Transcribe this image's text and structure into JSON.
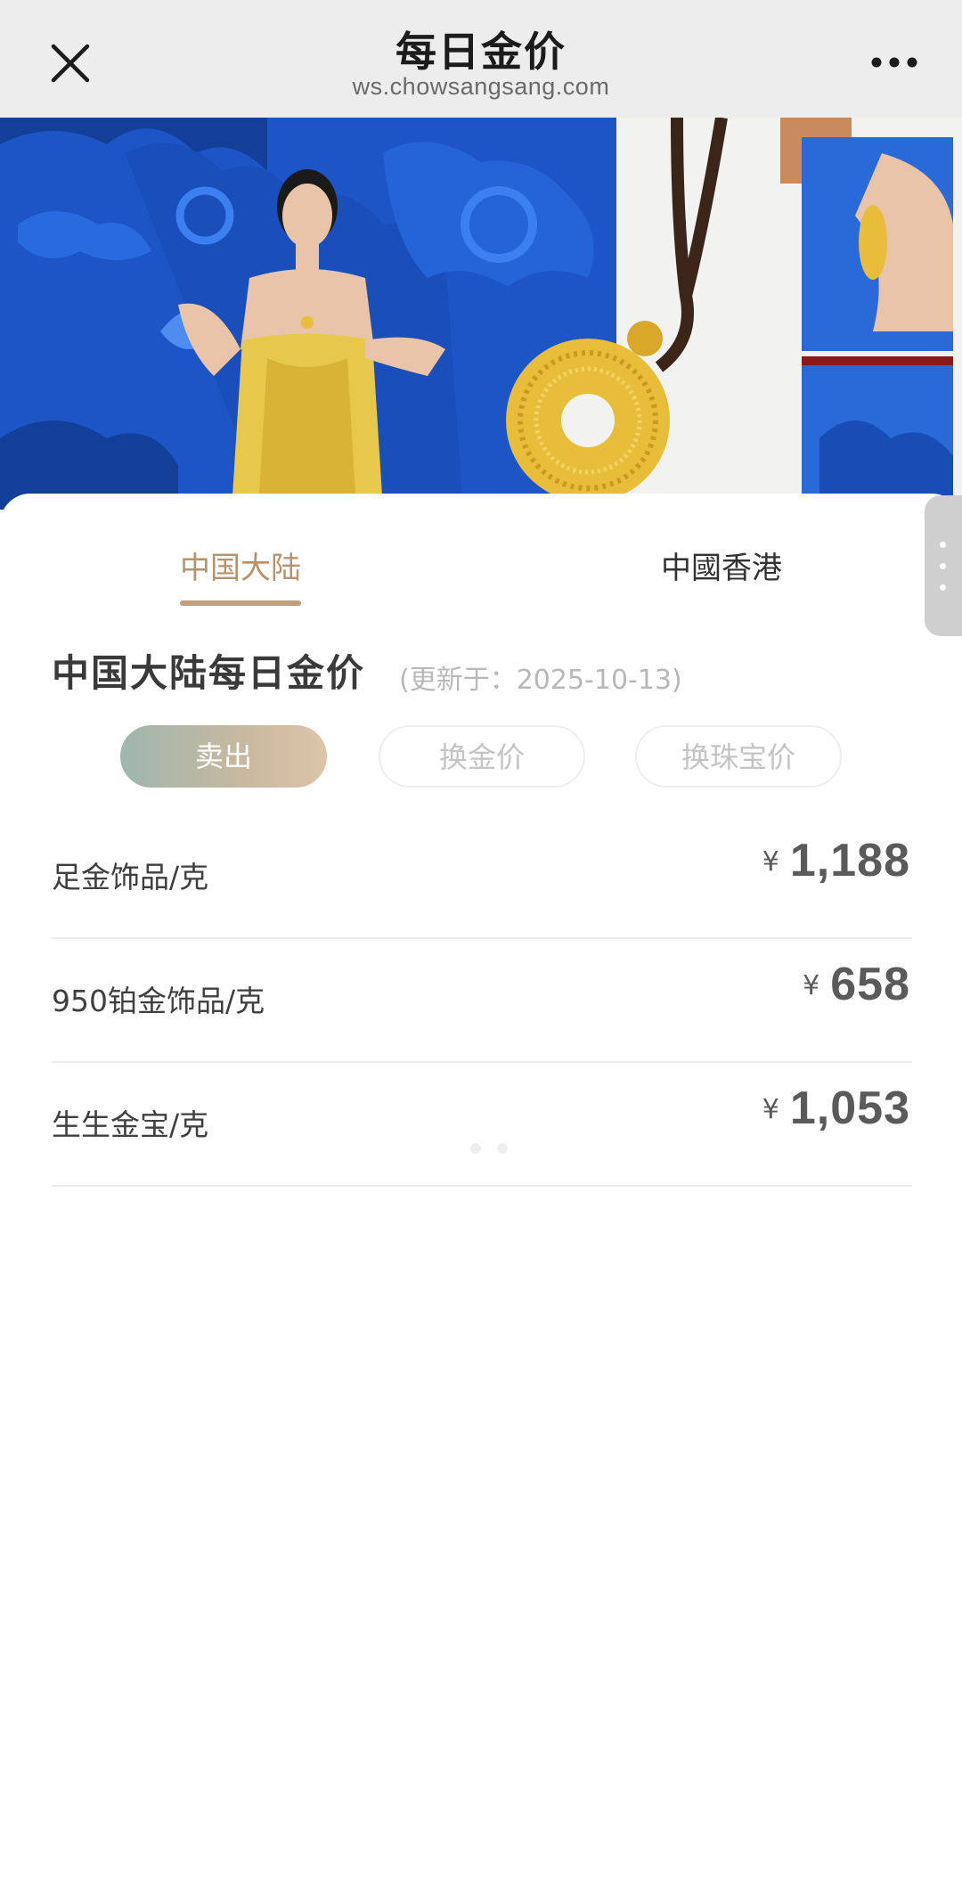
{
  "navbar": {
    "title": "每日金价",
    "url": "ws.chowsangsang.com",
    "close_icon": "close-icon",
    "more_icon": "more-dots-icon"
  },
  "banner": {
    "description_icon": "promo-banner-image"
  },
  "tabs": [
    {
      "label": "中国大陆",
      "active": true
    },
    {
      "label": "中國香港",
      "active": false
    }
  ],
  "section": {
    "title": "中国大陆每日金价",
    "updated": "(更新于：2025-10-13)"
  },
  "price_types": [
    {
      "label": "卖出",
      "active": true
    },
    {
      "label": "换金价",
      "active": false
    },
    {
      "label": "换珠宝价",
      "active": false
    }
  ],
  "prices": [
    {
      "item": "足金饰品/克",
      "currency": "¥",
      "amount": "1,188"
    },
    {
      "item": "950铂金饰品/克",
      "currency": "¥",
      "amount": "658"
    },
    {
      "item": "生生金宝/克",
      "currency": "¥",
      "amount": "1,053"
    }
  ],
  "colors": {
    "accent": "#b8926a",
    "nav_bg": "#ededed",
    "banner_blue": "#1f56c4",
    "gold": "#e8bd3a"
  }
}
